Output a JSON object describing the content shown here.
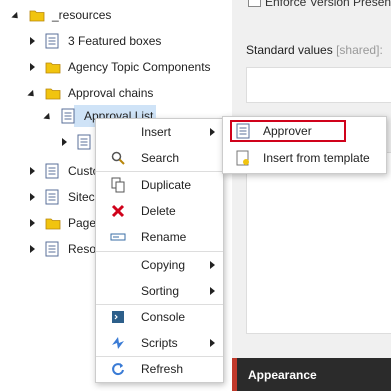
{
  "tree": {
    "items": [
      {
        "label": "_resources",
        "kind": "folder",
        "expanded": true
      },
      {
        "label": "3 Featured boxes",
        "kind": "doc",
        "expanded": false
      },
      {
        "label": "Agency Topic Components",
        "kind": "folder",
        "expanded": false
      },
      {
        "label": "Approval chains",
        "kind": "folder",
        "expanded": true
      },
      {
        "label": "Approval List",
        "kind": "doc",
        "expanded": true,
        "selected": true
      },
      {
        "label": "",
        "kind": "doc",
        "expanded": false
      },
      {
        "label": "Custo",
        "kind": "doc",
        "expanded": false
      },
      {
        "label": "Siteco",
        "kind": "doc",
        "expanded": false
      },
      {
        "label": "Page",
        "kind": "folder",
        "expanded": false
      },
      {
        "label": "Resou",
        "kind": "doc",
        "expanded": false
      }
    ]
  },
  "right_panel": {
    "enforce_label": "Enforce Version Presence",
    "standard_values_label": "Standard values",
    "standard_values_shared": "[shared]:",
    "appearance_label": "Appearance",
    "colors": {
      "header_bg": "#2b2b2b",
      "accent": "#c0392b"
    }
  },
  "context_menu": {
    "items": [
      {
        "label": "Insert",
        "icon": "none",
        "submenu": true
      },
      {
        "label": "Search",
        "icon": "search-icon",
        "submenu": false
      },
      {
        "label": "Duplicate",
        "icon": "duplicate-icon",
        "submenu": false
      },
      {
        "label": "Delete",
        "icon": "delete-icon",
        "submenu": false
      },
      {
        "label": "Rename",
        "icon": "rename-icon",
        "submenu": false
      },
      {
        "label": "Copying",
        "icon": "none",
        "submenu": true
      },
      {
        "label": "Sorting",
        "icon": "none",
        "submenu": true
      },
      {
        "label": "Console",
        "icon": "console-icon",
        "submenu": false
      },
      {
        "label": "Scripts",
        "icon": "scripts-icon",
        "submenu": true
      },
      {
        "label": "Refresh",
        "icon": "refresh-icon",
        "submenu": false
      }
    ]
  },
  "insert_submenu": {
    "items": [
      {
        "label": "Approver",
        "icon": "approver-icon",
        "highlighted": true
      },
      {
        "label": "Insert from template",
        "icon": "insert-template-icon",
        "highlighted": false
      }
    ],
    "highlight_color": "#d0021b"
  }
}
